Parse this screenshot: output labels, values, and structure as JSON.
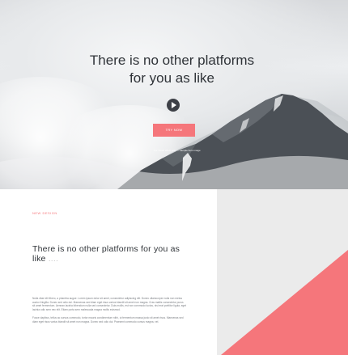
{
  "hero": {
    "title": "There is no other platforms for you as like",
    "play_icon": "play-icon",
    "try_button_label": "TRY NOW",
    "caption": "For visual effect only — sample hero image"
  },
  "section": {
    "kicker": "NEW DESIGN",
    "title": "There is no other platforms for you as like",
    "title_ellipsis": "....",
    "paragraphs": [
      "Nulla vitae elit libero, a pharetra augue. Lorem ipsum dolor sit amet, consectetur adipiscing elit. Donec ullamcorper nulla non metus auctor fringilla. Donec sed odio dui. Maecenas sed diam eget risus varius blandit sit amet non magna. Cras mattis consectetur purus sit amet fermentum. Aenean lacinia bibendum nulla sed consectetur. Duis mollis, est non commodo luctus, nisi erat porttitor ligula, eget lacinia odio sem nec elit. Etiam porta sem malesuada magna mollis euismod.",
      "Fusce dapibus, tellus ac cursus commodo, tortor mauris condimentum nibh, ut fermentum massa justo sit amet risus. Maecenas sed diam eget risus varius blandit sit amet non magna. Donec sed odio dui. Praesent commodo cursus magna, vel."
    ]
  },
  "colors": {
    "accent": "#f5767b",
    "dark": "#2f3338",
    "panel": "#ebebeb"
  }
}
